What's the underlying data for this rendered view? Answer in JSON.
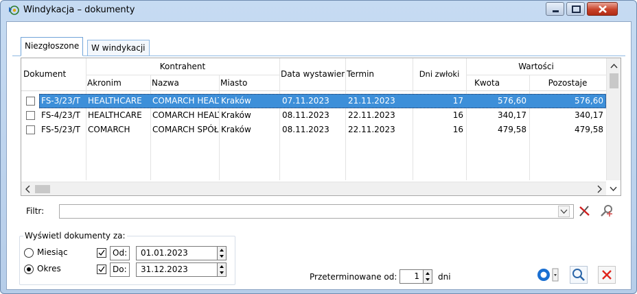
{
  "window": {
    "title": "Windykacja – dokumenty"
  },
  "tabs": [
    {
      "label": "Niezgłoszone",
      "active": true
    },
    {
      "label": "W windykacji",
      "active": false
    }
  ],
  "table": {
    "group_headers": {
      "kontrahent": "Kontrahent",
      "wartosci": "Wartości"
    },
    "columns": {
      "dokument": "Dokument",
      "akronim": "Akronim",
      "nazwa": "Nazwa",
      "miasto": "Miasto",
      "data": "Data wystawienia",
      "termin": "Termin",
      "dni": "Dni zwłoki",
      "kwota": "Kwota",
      "pozostaje": "Pozostaje"
    },
    "rows": [
      {
        "dokument": "FS-3/23/T",
        "akronim": "HEALTHCARE",
        "nazwa": "COMARCH HEALTHCARE",
        "miasto": "Kraków",
        "data": "07.11.2023",
        "termin": "21.11.2023",
        "dni": "17",
        "kwota": "576,60",
        "pozostaje": "576,60",
        "selected": true
      },
      {
        "dokument": "FS-4/23/T",
        "akronim": "HEALTHCARE",
        "nazwa": "COMARCH HEALTHCARE",
        "miasto": "Kraków",
        "data": "08.11.2023",
        "termin": "22.11.2023",
        "dni": "16",
        "kwota": "340,17",
        "pozostaje": "340,17",
        "selected": false
      },
      {
        "dokument": "FS-5/23/T",
        "akronim": "COMARCH",
        "nazwa": "COMARCH SPÓŁKA",
        "miasto": "Kraków",
        "data": "08.11.2023",
        "termin": "22.11.2023",
        "dni": "16",
        "kwota": "479,58",
        "pozostaje": "479,58",
        "selected": false
      }
    ]
  },
  "filter": {
    "label": "Filtr:",
    "value": ""
  },
  "period": {
    "group_title": "Wyświetl dokumenty za:",
    "radio_month": "Miesiąc",
    "radio_range": "Okres",
    "from_label": "Od:",
    "from_value": "01.01.2023",
    "to_label": "Do:",
    "to_value": "31.12.2023"
  },
  "overdue": {
    "label": "Przeterminowane od:",
    "value": "1",
    "unit": "dni"
  },
  "colors": {
    "selection": "#3d8fd9",
    "close_red": "#c8432a",
    "accent_blue": "#1a6fd1"
  },
  "icons": [
    "app-icon",
    "minimize-icon",
    "maximize-icon",
    "close-icon",
    "clear-filter-icon",
    "filter-settings-icon",
    "refresh-icon",
    "search-icon",
    "cancel-icon"
  ]
}
